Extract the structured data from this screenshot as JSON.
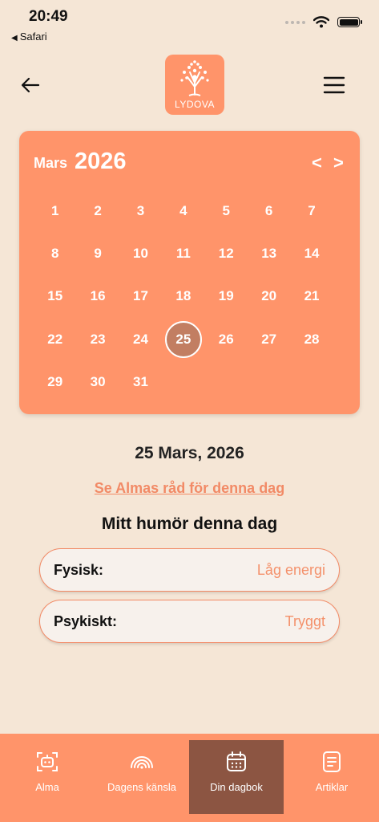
{
  "status": {
    "time": "20:49",
    "back_app": "Safari"
  },
  "header": {
    "logo_text": "LYDOVA"
  },
  "calendar": {
    "month": "Mars",
    "year": "2026",
    "prev": "<",
    "next": ">",
    "days": [
      "1",
      "2",
      "3",
      "4",
      "5",
      "6",
      "7",
      "8",
      "9",
      "10",
      "11",
      "12",
      "13",
      "14",
      "15",
      "16",
      "17",
      "18",
      "19",
      "20",
      "21",
      "22",
      "23",
      "24",
      "25",
      "26",
      "27",
      "28",
      "29",
      "30",
      "31"
    ],
    "selected_day": "25"
  },
  "main": {
    "date_heading": "25 Mars, 2026",
    "advice_link": "Se Almas råd för denna dag",
    "mood_heading": "Mitt humör denna dag",
    "moods": [
      {
        "label": "Fysisk:",
        "value": "Låg energi"
      },
      {
        "label": "Psykiskt:",
        "value": "Tryggt"
      }
    ]
  },
  "nav": {
    "items": [
      {
        "label": "Alma",
        "icon": "robot-icon"
      },
      {
        "label": "Dagens känsla",
        "icon": "mood-gauge-icon"
      },
      {
        "label": "Din dagbok",
        "icon": "calendar-icon"
      },
      {
        "label": "Artiklar",
        "icon": "article-icon"
      }
    ],
    "active": "Din dagbok"
  },
  "colors": {
    "background": "#f5e6d6",
    "accent": "#ff946a",
    "selected_day": "#c27e62",
    "active_nav": "#8c5542",
    "link": "#f28a66"
  }
}
